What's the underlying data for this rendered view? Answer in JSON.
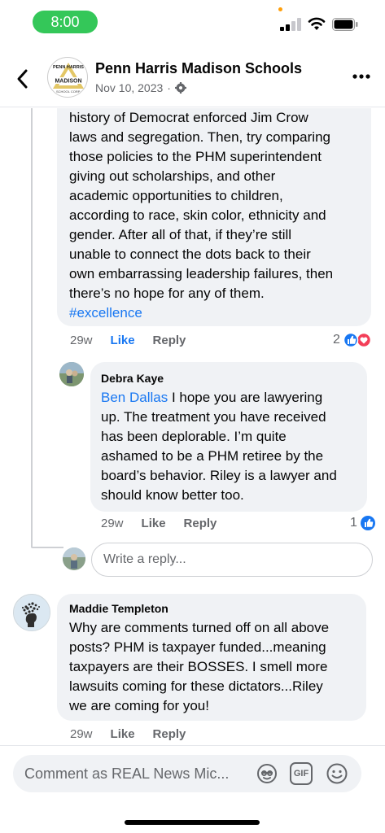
{
  "status_bar": {
    "time": "8:00"
  },
  "header": {
    "page_name": "Penn Harris Madison Schools",
    "post_date": "Nov 10, 2023",
    "separator": "·"
  },
  "comment1": {
    "lines": [
      "history of Democrat enforced Jim Crow",
      "laws and segregation. Then, try comparing",
      "those policies to the PHM superintendent",
      "giving out scholarships, and other",
      "academic opportunities to children,",
      "according to race, skin color, ethnicity and",
      "gender. After all of that, if they’re still",
      "unable to connect the dots back to their",
      "own embarrassing leadership failures, then",
      "there’s no hope for any of them."
    ],
    "hashtag": "#excellence",
    "time": "29w",
    "like": "Like",
    "reply": "Reply",
    "reaction_count": "2"
  },
  "reply1": {
    "author": "Debra Kaye",
    "mention": "Ben Dallas",
    "first_line_rest": " I hope you are lawyering",
    "lines": [
      "up. The treatment you have received",
      "has been deplorable. I’m quite",
      "ashamed to be a PHM retiree by the",
      "board’s behavior. Riley is a lawyer and",
      "should know better too."
    ],
    "time": "29w",
    "like": "Like",
    "reply": "Reply",
    "reaction_count": "1"
  },
  "reply_input": {
    "placeholder": "Write a reply..."
  },
  "comment2": {
    "author": "Maddie Templeton",
    "lines": [
      "Why are comments turned off on all above",
      "posts? PHM is taxpayer funded...meaning",
      "taxpayers are their BOSSES. I smell more",
      "lawsuits coming for these dictators...Riley",
      "we are coming for you!"
    ],
    "time": "29w",
    "like": "Like",
    "reply": "Reply"
  },
  "composer": {
    "placeholder": "Comment as REAL News Mic...",
    "gif_label": "GIF"
  },
  "logo": {
    "text_top": "PENN HARRIS",
    "text_mid": "MADISON",
    "text_bottom": "SCHOOL CORP."
  },
  "icons": {
    "back": "chevron-left-icon",
    "globe": "globe-icon",
    "more": "more-icon",
    "like_reaction": "like-reaction-icon",
    "love_reaction": "love-reaction-icon",
    "avatar_sticker": "avatar-sticker-icon",
    "gif": "gif-icon",
    "emoji": "emoji-icon"
  },
  "colors": {
    "accent": "#1877f2",
    "status_green": "#34c759",
    "love_red": "#f33e58",
    "bubble": "#f0f2f5",
    "secondary_text": "#65676b"
  }
}
